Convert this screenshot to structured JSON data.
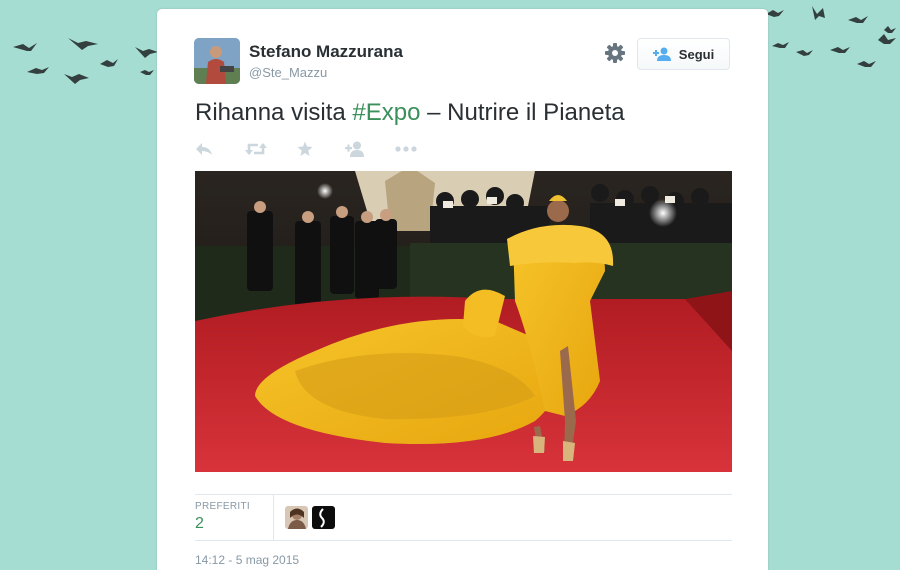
{
  "colors": {
    "background": "#a6ddd3",
    "hashtag": "#3b8f5a",
    "text": "#292f33",
    "muted": "#8899a6"
  },
  "tweet": {
    "author_name": "Stefano Mazzurana",
    "author_handle": "@Ste_Mazzu",
    "follow_label": "Segui",
    "text_before": "Rihanna visita ",
    "hashtag": "#Expo",
    "text_after": " – Nutrire il Pianeta",
    "actions": [
      "reply-icon",
      "retweet-icon",
      "favorite-icon",
      "follow-icon",
      "more-icon"
    ],
    "stats": {
      "favorites_label": "PREFERITI",
      "favorites_count": "2"
    },
    "timestamp": "14:12 - 5 mag 2015"
  }
}
